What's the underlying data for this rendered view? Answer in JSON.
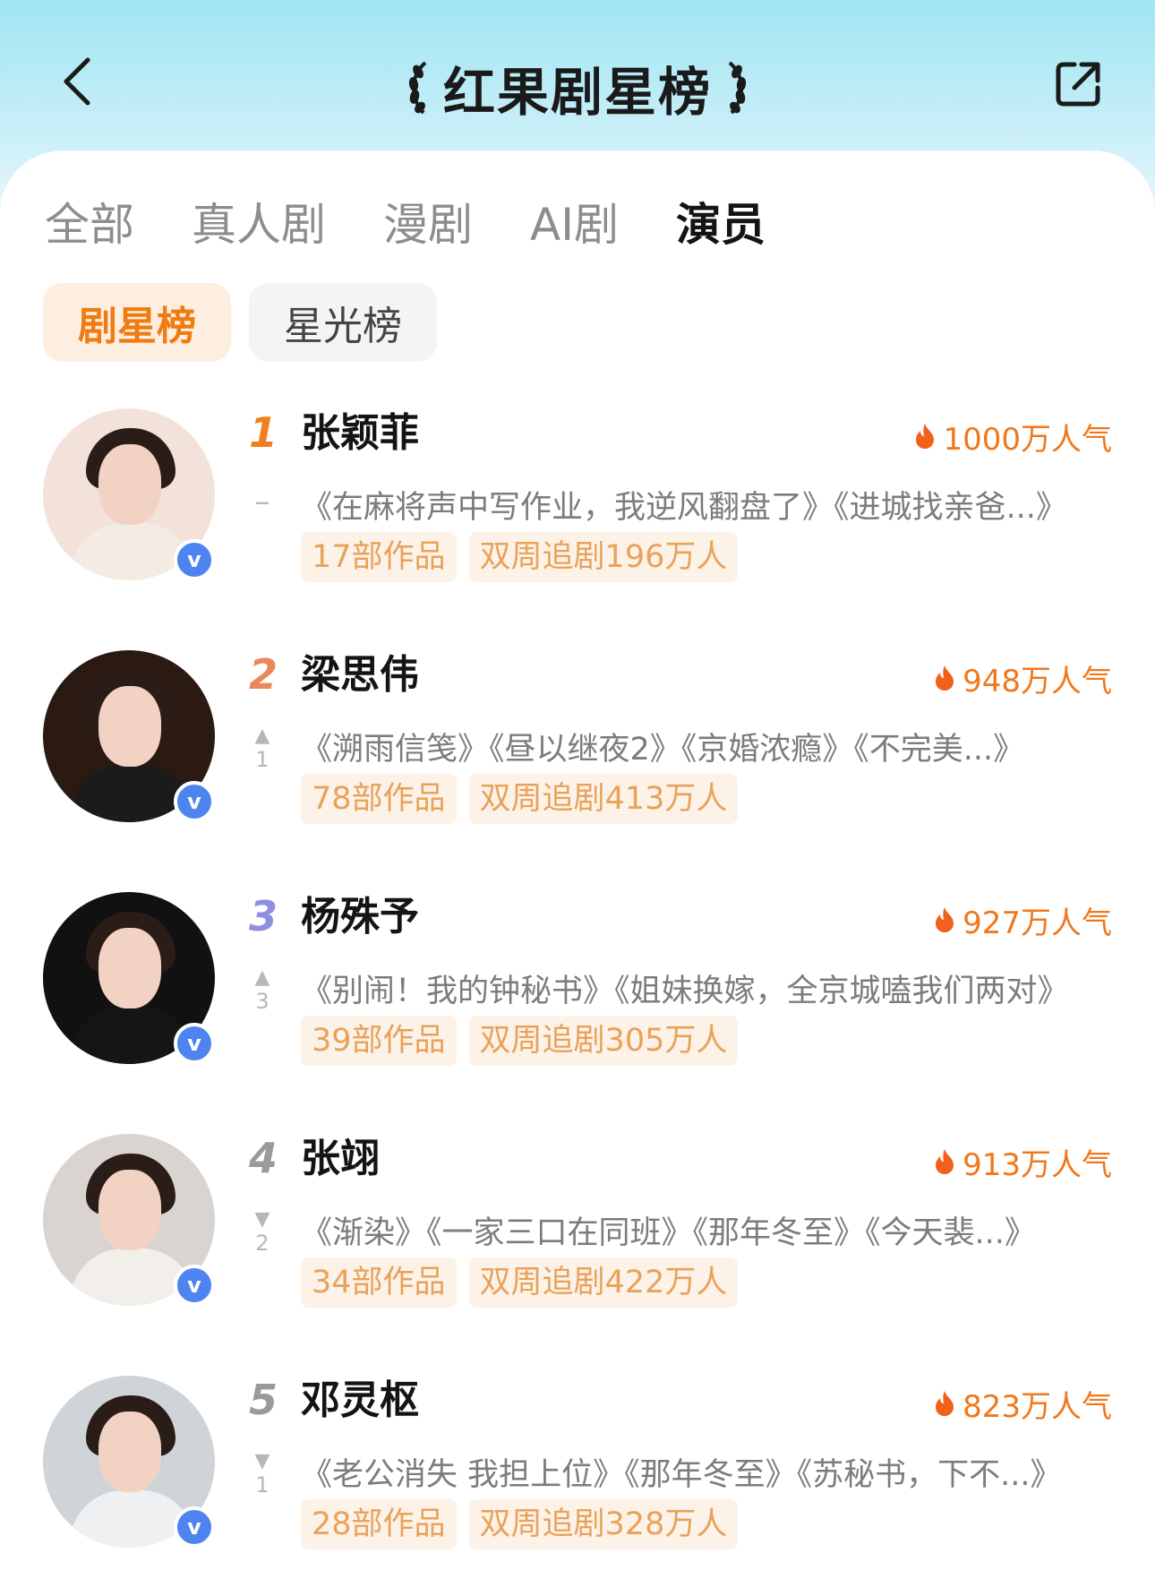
{
  "header": {
    "title": "红果剧星榜"
  },
  "tabs": [
    "全部",
    "真人剧",
    "漫剧",
    "AI剧",
    "演员"
  ],
  "active_tab": "演员",
  "subtabs": [
    "剧星榜",
    "星光榜"
  ],
  "active_subtab": "剧星榜",
  "rows": [
    {
      "rank": "1",
      "rank_color": "#f0801e",
      "trend": "flat",
      "trend_symbol": "–",
      "change": "",
      "name": "张颖菲",
      "popularity": "1000万人气",
      "works": "《在麻将声中写作业，我逆风翻盘了》《进城找亲爸...》",
      "tags": [
        "17部作品",
        "双周追剧196万人"
      ],
      "avatar": {
        "bg": "#f3e2d9",
        "accent": "#f7c9cf",
        "clothes": "#f4ece2"
      }
    },
    {
      "rank": "2",
      "rank_color": "#e9895b",
      "trend": "up",
      "trend_symbol": "▲",
      "change": "1",
      "name": "梁思伟",
      "popularity": "948万人气",
      "works": "《溯雨信笺》《昼以继夜2》《京婚浓瘾》《不完美...》",
      "tags": [
        "78部作品",
        "双周追剧413万人"
      ],
      "avatar": {
        "bg": "#2a1a12",
        "accent": "#6b4a2e",
        "clothes": "#1b1b1b"
      }
    },
    {
      "rank": "3",
      "rank_color": "#8e8fe0",
      "trend": "up",
      "trend_symbol": "▲",
      "change": "3",
      "name": "杨殊予",
      "popularity": "927万人气",
      "works": "《别闹！我的钟秘书》《姐妹换嫁，全京城嗑我们两对》",
      "tags": [
        "39部作品",
        "双周追剧305万人"
      ],
      "avatar": {
        "bg": "#111111",
        "accent": "#3a3a3a",
        "clothes": "#151515"
      }
    },
    {
      "rank": "4",
      "rank_color": "#9a9a9a",
      "trend": "down",
      "trend_symbol": "▼",
      "change": "2",
      "name": "张翊",
      "popularity": "913万人气",
      "works": "《渐染》《一家三口在同班》《那年冬至》《今天裴...》",
      "tags": [
        "34部作品",
        "双周追剧422万人"
      ],
      "avatar": {
        "bg": "#d9d4cf",
        "accent": "#f0ece6",
        "clothes": "#f2efea"
      }
    },
    {
      "rank": "5",
      "rank_color": "#9a9a9a",
      "trend": "down",
      "trend_symbol": "▼",
      "change": "1",
      "name": "邓灵枢",
      "popularity": "823万人气",
      "works": "《老公消失 我担上位》《那年冬至》《苏秘书，下不...》",
      "tags": [
        "28部作品",
        "双周追剧328万人"
      ],
      "avatar": {
        "bg": "#cfd4d8",
        "accent": "#e3e6e8",
        "clothes": "#eef0f1"
      }
    }
  ]
}
